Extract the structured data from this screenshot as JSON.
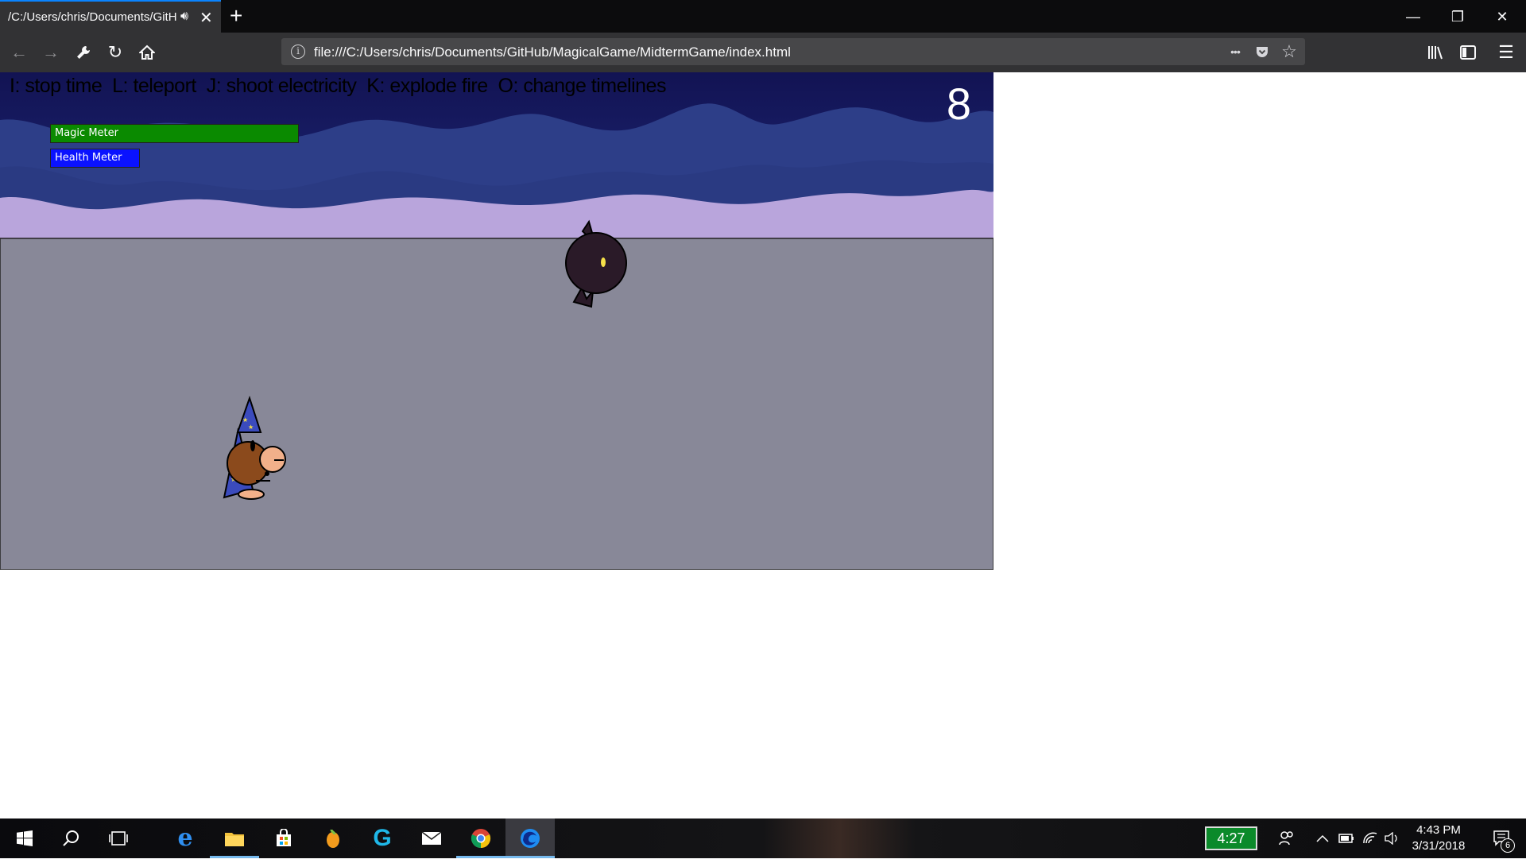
{
  "browser": {
    "tab_title": "/C:/Users/chris/Documents/GitH",
    "tab_audio_icon": "speaker-icon",
    "tab_close": "✕",
    "new_tab": "+",
    "window_controls": {
      "minimize": "—",
      "restore": "❐",
      "close": "✕"
    },
    "url": "file:///C:/Users/chris/Documents/GitHub/MagicalGame/MidtermGame/index.html",
    "nav": {
      "back": "←",
      "forward": "→",
      "tools": "🔧",
      "reload": "↻",
      "home": "⌂"
    },
    "url_actions": {
      "more": "•••",
      "pocket": "pocket-icon",
      "bookmark": "☆"
    },
    "toolbar_right": {
      "library": "library-icon",
      "sidebar": "sidebar-icon",
      "menu": "☰"
    }
  },
  "game": {
    "controls_text": "I: stop time  L: teleport  J: shoot electricity  K: explode fire  O: change timelines",
    "score": "8",
    "magic_meter": {
      "label": "Magic Meter",
      "level": 1.0,
      "color": "#0a8a00"
    },
    "health_meter": {
      "label": "Health Meter",
      "level": 0.36,
      "color": "#0a12ff"
    },
    "colors": {
      "sky": "#15175e",
      "far_mountains": "#2d3e88",
      "near_hills": "#b9a5dc",
      "ground": "#888898",
      "wizard_skin": "#8b4a1c",
      "wizard_robe": "#3b4bbd",
      "enemy_body": "#2a1a28",
      "enemy_eye": "#f5e04a"
    },
    "characters": [
      {
        "name": "wizard",
        "role": "player"
      },
      {
        "name": "shadow-creature",
        "role": "enemy"
      }
    ]
  },
  "taskbar": {
    "apps": [
      "windows-start-icon",
      "search-icon",
      "task-view-icon",
      "edge-icon",
      "file-explorer-icon",
      "store-icon",
      "fl-studio-icon",
      "logitech-icon",
      "mail-icon",
      "chrome-icon",
      "firefox-icon"
    ],
    "battery_app_text": "4:27",
    "time": "4:43 PM",
    "date": "3/31/2018",
    "notification_count": "6"
  }
}
